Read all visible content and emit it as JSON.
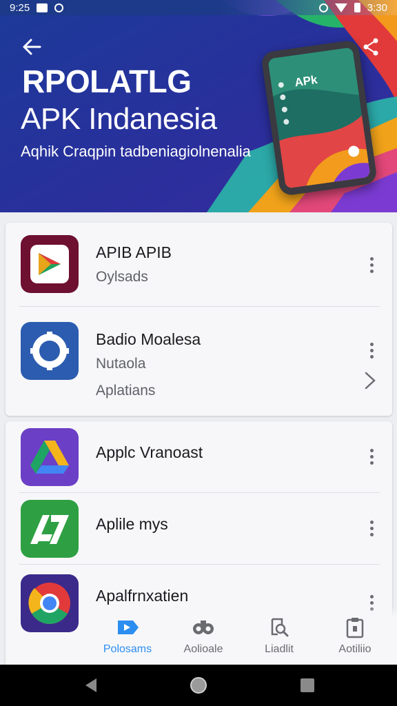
{
  "status_bar": {
    "time": "9:25",
    "right_text": "3:30"
  },
  "hero": {
    "title_line1": "RPOLATLG",
    "title_line2": "APK Indanesia",
    "subtitle": "Aqhik Craqpin tadbeniagiolnenalia",
    "phone_label": "APk",
    "back_icon": "back-arrow-icon",
    "share_icon": "share-icon"
  },
  "apps_section1": [
    {
      "name": "APIB APIB",
      "subtitle": "Oylsads",
      "icon": "play-store-icon",
      "color": "#7a1230"
    },
    {
      "name": "Badio Moalesa",
      "subtitle": "Nutaola",
      "extra": "Aplatians",
      "icon": "gear-icon",
      "color": "#2c5cb0"
    }
  ],
  "apps_section2": [
    {
      "name": "Applc Vranoast",
      "icon": "drive-icon",
      "color": "#6b3fc6"
    },
    {
      "name": "Aplile mys",
      "icon": "app-a-icon",
      "color": "#2ea043"
    },
    {
      "name": "Apalfrnxatien",
      "icon": "chrome-icon",
      "color": "#3b2a8a"
    }
  ],
  "tabs": [
    {
      "label": "Polosams",
      "icon": "video-tag-icon",
      "active": true
    },
    {
      "label": "Aolioale",
      "icon": "binoculars-icon",
      "active": false
    },
    {
      "label": "Liadlit",
      "icon": "search-doc-icon",
      "active": false
    },
    {
      "label": "Aotiliio",
      "icon": "clipboard-icon",
      "active": false
    }
  ],
  "nav": {
    "back": "nav-back-icon",
    "home": "nav-home-icon",
    "recents": "nav-recents-icon"
  }
}
